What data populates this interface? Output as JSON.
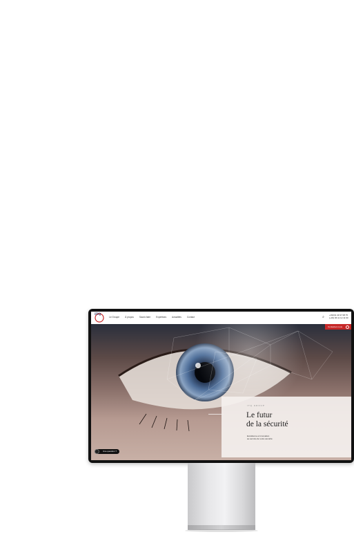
{
  "header": {
    "logo_text": "ITQ",
    "nav": [
      "Le Groupe",
      "À propos",
      "Savoir-faire",
      "Expertises",
      "Actualités",
      "Contact"
    ],
    "phone_line1": "+33(0)1 40 37 08 75",
    "phone_line2": "(+33) 06 11 12 11 90"
  },
  "hero": {
    "cta_label": "Contactez-nous",
    "eyebrow": "ITQ GROUP",
    "title_line1": "Le futur",
    "title_line2": "de la sécurité",
    "subtitle_line1": "Excellence et innovation",
    "subtitle_line2": "au service de votre sécurité"
  },
  "chat": {
    "label": "Une question ?"
  },
  "colors": {
    "accent": "#c62828",
    "navy": "#1b2b5a",
    "bezel": "#111111"
  },
  "icons": [
    "logo-icon",
    "search-icon",
    "chat-icon",
    "arrow-right-icon"
  ]
}
